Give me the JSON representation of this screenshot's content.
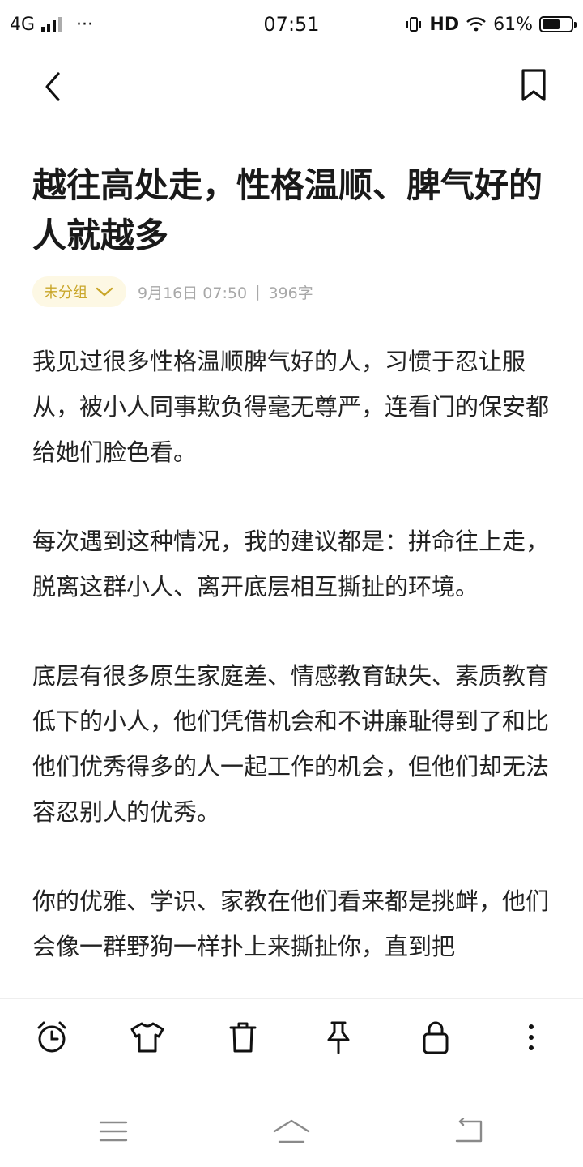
{
  "status_bar": {
    "network": "4G",
    "dots": "···",
    "time": "07:51",
    "hd": "HD",
    "battery_text": "61%",
    "battery_level_percent": 61
  },
  "header": {
    "back_icon": "chevron-left-icon",
    "bookmark_icon": "bookmark-icon"
  },
  "note": {
    "title": "越往高处走，性格温顺、脾气好的人就越多",
    "group_label": "未分组",
    "date": "9月16日 07:50",
    "separator": "|",
    "word_count": "396字",
    "accent_color": "#c9a62a",
    "paragraphs": [
      "我见过很多性格温顺脾气好的人，习惯于忍让服从，被小人同事欺负得毫无尊严，连看门的保安都给她们脸色看。",
      "每次遇到这种情况，我的建议都是：拼命往上走，脱离这群小人、离开底层相互撕扯的环境。",
      "底层有很多原生家庭差、情感教育缺失、素质教育低下的小人，他们凭借机会和不讲廉耻得到了和比他们优秀得多的人一起工作的机会，但他们却无法容忍别人的优秀。",
      "你的优雅、学识、家教在他们看来都是挑衅，他们会像一群野狗一样扑上来撕扯你，直到把"
    ]
  },
  "toolbar": {
    "icons": [
      "alarm-clock-icon",
      "shirt-icon",
      "trash-icon",
      "pin-icon",
      "lock-icon",
      "more-vertical-icon"
    ]
  },
  "navigation": {
    "icons": [
      "menu-icon",
      "home-icon",
      "back-icon"
    ]
  }
}
